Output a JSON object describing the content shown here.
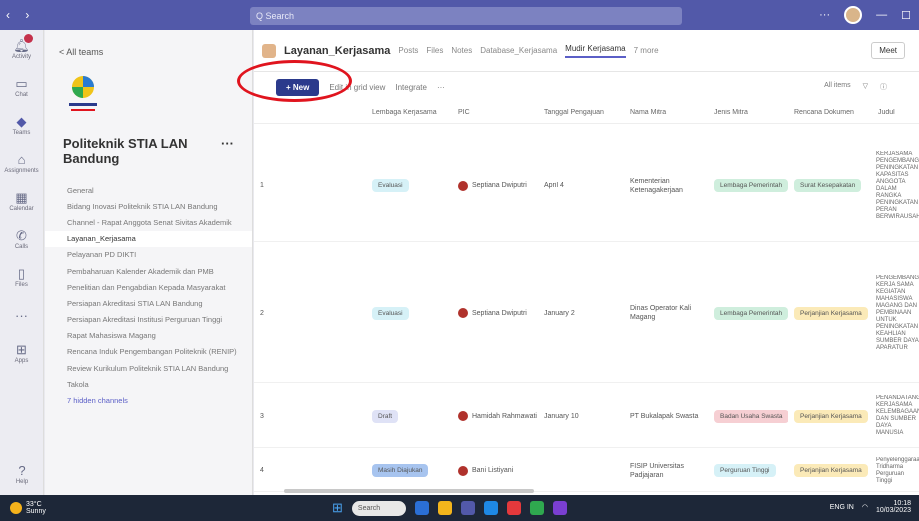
{
  "titlebar": {
    "search_placeholder": "Q Search",
    "more": "···"
  },
  "rail": [
    {
      "label": "Activity",
      "icon": "bell-icon"
    },
    {
      "label": "Chat",
      "icon": "chat-icon"
    },
    {
      "label": "Teams",
      "icon": "teams-icon"
    },
    {
      "label": "Assignments",
      "icon": "assignments-icon"
    },
    {
      "label": "Calendar",
      "icon": "calendar-icon"
    },
    {
      "label": "Calls",
      "icon": "phone-icon"
    },
    {
      "label": "Files",
      "icon": "files-icon"
    },
    {
      "label": "",
      "icon": "more-icon"
    },
    {
      "label": "Apps",
      "icon": "apps-icon"
    }
  ],
  "rail_help": "Help",
  "sidebar": {
    "back_label": "< All teams",
    "team_name": "Politeknik STIA LAN Bandung",
    "channels": [
      "General",
      "Bidang Inovasi Politeknik STIA LAN Bandung",
      "Channel - Rapat Anggota Senat Sivitas Akademik",
      "Layanan_Kerjasama",
      "Pelayanan PD DIKTI",
      "Pembaharuan Kalender Akademik dan PMB",
      "Penelitian dan Pengabdian Kepada Masyarakat",
      "Persiapan Akreditasi STIA LAN Bandung",
      "Persiapan Akreditasi Institusi Perguruan Tinggi",
      "Rapat Mahasiswa Magang",
      "Rencana Induk Pengembangan Politeknik (RENIP)",
      "Review Kurikulum Politeknik STIA LAN Bandung",
      "Takola"
    ],
    "hidden": "7 hidden channels",
    "active_index": 3
  },
  "main": {
    "channel_name": "Layanan_Kerjasama",
    "tabs": [
      "Posts",
      "Files",
      "Notes",
      "Database_Kerjasama",
      "Mudir Kerjasama",
      "7 more"
    ],
    "active_tab": 4,
    "meet": "Meet",
    "toolbar": {
      "new": "+ New",
      "edit": "Edit in grid view",
      "integrate": "Integrate",
      "more": "···"
    },
    "filter": {
      "all": "All items",
      "filter_icon": "filter-icon",
      "info_icon": "info-icon"
    },
    "columns": [
      "",
      "Lembaga Kerjasama",
      "PIC",
      "Tanggal Pengajuan",
      "Nama Mitra",
      "Jenis Mitra",
      "Rencana Dokumen",
      "Judul"
    ],
    "rows": [
      {
        "num": "1",
        "status": "Evaluasi",
        "status_color": "#d6f1f7",
        "pic": "Septiana Dwiputri",
        "date": "April 4",
        "mitra": "Kementerian Ketenagakerjaan",
        "jenis": "Lembaga Pemerintah",
        "jenis_color": "#cfeedd",
        "dok": "Surat Kesepakatan",
        "dok_color": "#cfeedd",
        "judul": "KERJASAMA PENGEMBANGAN PENINGKATAN KAPASITAS ANGGOTA DALAM RANGKA PENINGKATAN PERAN BERWIRAUSAHA"
      },
      {
        "num": "2",
        "status": "Evaluasi",
        "status_color": "#d6f1f7",
        "pic": "Septiana Dwiputri",
        "date": "January 2",
        "mitra": "Dinas Operator Kali Magang",
        "jenis": "Lembaga Pemerintah",
        "jenis_color": "#cfeedd",
        "dok": "Perjanjian Kerjasama",
        "dok_color": "#fbeab8",
        "judul": "PENGEMBANGAN KERJA SAMA KEGIATAN MAHASISWA MAGANG DAN PEMBINAAN UNTUK PENINGKATAN KEAHLIAN SUMBER DAYA APARATUR"
      },
      {
        "num": "3",
        "status": "Draft",
        "status_color": "#dfe2f6",
        "pic": "Hamidah Rahmawati",
        "date": "January 10",
        "mitra": "PT Bukalapak Swasta",
        "jenis": "Badan Usaha Swasta",
        "jenis_color": "#f6cfd3",
        "dok": "Perjanjian Kerjasama",
        "dok_color": "#fbeab8",
        "judul": "PENANDATANGANAN KERJASAMA KELEMBAGAAN DAN SUMBER DAYA MANUSIA"
      },
      {
        "num": "4",
        "status": "Masih Diajukan",
        "status_color": "#a7c4ef",
        "pic": "Bani Listiyani",
        "date": "",
        "mitra": "FISIP Universitas Padjajaran",
        "jenis": "Perguruan Tinggi",
        "jenis_color": "#d6f1f7",
        "dok": "Perjanjian Kerjasama",
        "dok_color": "#fbeab8",
        "judul": "Penyelenggaraan Tridharma Perguruan Tinggi"
      }
    ]
  },
  "taskbar": {
    "weather_temp": "33°C",
    "weather_desc": "Sunny",
    "search": "Search",
    "lang": "ENG IN",
    "time": "10:18",
    "date": "10/03/2023",
    "apps": [
      "#2b6fd6",
      "#f3b51c",
      "#5259a9",
      "#1e88e5",
      "#e4393c",
      "#2fa84f",
      "#7a3fd1"
    ]
  },
  "colors": {
    "accent": "#5259a9",
    "new_button": "#2b3a8c",
    "highlight": "#e0141e"
  }
}
